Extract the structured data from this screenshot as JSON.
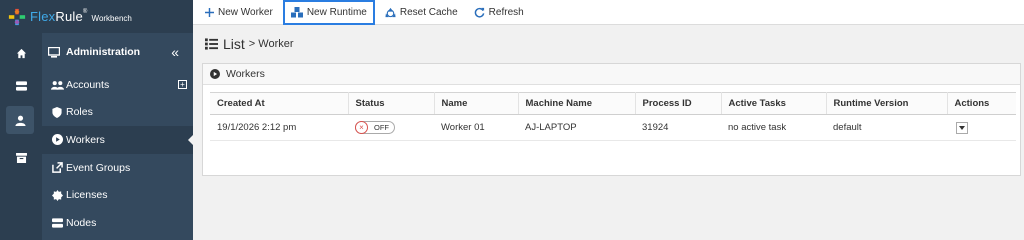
{
  "brand": {
    "name_part1": "Flex",
    "name_part2": "Rule",
    "reg": "®",
    "subtitle": "Workbench"
  },
  "rail": {
    "icons": [
      "home-icon",
      "server-icon",
      "user-icon",
      "archive-icon"
    ],
    "active_index": 2
  },
  "sidebar": {
    "header": {
      "label": "Administration",
      "collapse": "«"
    },
    "items": [
      {
        "label": "Accounts",
        "icon": "users-icon",
        "expandable": true
      },
      {
        "label": "Roles",
        "icon": "shield-icon"
      },
      {
        "label": "Workers",
        "icon": "play-circle-icon",
        "active": true
      },
      {
        "label": "Event Groups",
        "icon": "external-link-icon"
      },
      {
        "label": "Licenses",
        "icon": "certificate-icon"
      },
      {
        "label": "Nodes",
        "icon": "server-icon"
      }
    ]
  },
  "toolbar": {
    "new_worker": "New Worker",
    "new_runtime": "New Runtime",
    "reset_cache": "Reset Cache",
    "refresh": "Refresh"
  },
  "page": {
    "title": "List",
    "subtitle": "> Worker"
  },
  "panel": {
    "title": "Workers"
  },
  "table": {
    "columns": [
      "Created At",
      "Status",
      "Name",
      "Machine Name",
      "Process ID",
      "Active Tasks",
      "Runtime Version",
      "Actions"
    ],
    "rows": [
      {
        "created_at": "19/1/2026 2:12 pm",
        "status": "OFF",
        "name": "Worker 01",
        "machine": "AJ-LAPTOP",
        "pid": "31924",
        "tasks": "no active task",
        "runtime": "default"
      }
    ]
  },
  "colors": {
    "sidebar": "#34495e",
    "rail": "#2c3e50",
    "accent": "#2a7de1",
    "off": "#d9534f"
  }
}
